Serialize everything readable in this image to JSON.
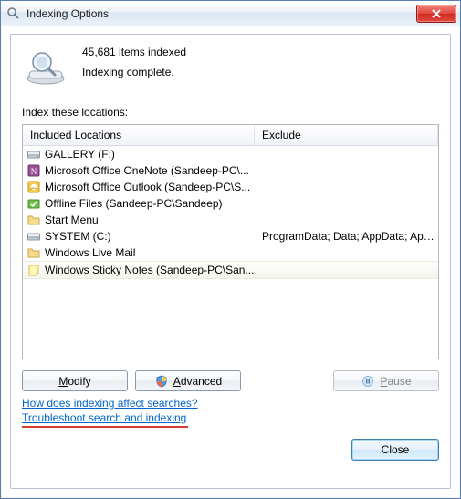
{
  "window": {
    "title": "Indexing Options"
  },
  "status": {
    "items_indexed": "45,681 items indexed",
    "state": "Indexing complete."
  },
  "section_label": "Index these locations:",
  "columns": {
    "included": "Included Locations",
    "exclude": "Exclude"
  },
  "rows": [
    {
      "icon": "drive",
      "label": "GALLERY (F:)",
      "exclude": ""
    },
    {
      "icon": "onenote",
      "label": "Microsoft Office OneNote (Sandeep-PC\\...",
      "exclude": ""
    },
    {
      "icon": "outlook",
      "label": "Microsoft Office Outlook (Sandeep-PC\\S...",
      "exclude": ""
    },
    {
      "icon": "offline",
      "label": "Offline Files (Sandeep-PC\\Sandeep)",
      "exclude": ""
    },
    {
      "icon": "folder",
      "label": "Start Menu",
      "exclude": ""
    },
    {
      "icon": "drive",
      "label": "SYSTEM (C:)",
      "exclude": "ProgramData; Data; AppData; AppData; ..."
    },
    {
      "icon": "folder",
      "label": "Windows Live Mail",
      "exclude": ""
    },
    {
      "icon": "sticky",
      "label": "Windows Sticky Notes (Sandeep-PC\\San...",
      "exclude": "",
      "selected": true
    }
  ],
  "buttons": {
    "modify_u": "M",
    "modify_rest": "odify",
    "advanced_u": "A",
    "advanced_rest": "dvanced",
    "pause_u": "P",
    "pause_rest": "ause",
    "close": "Close"
  },
  "links": {
    "help": "How does indexing affect searches?",
    "troubleshoot": "Troubleshoot search and indexing"
  }
}
